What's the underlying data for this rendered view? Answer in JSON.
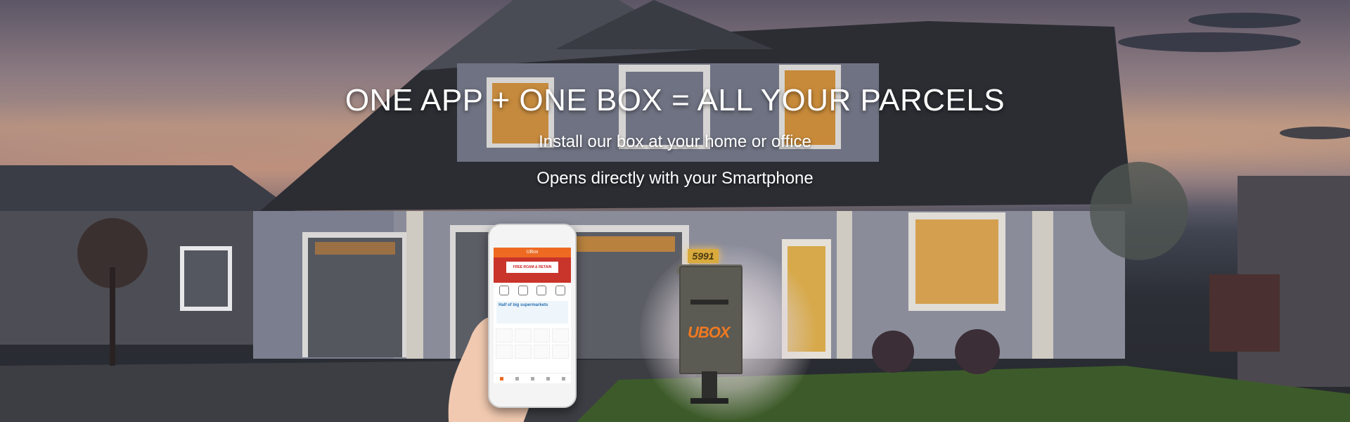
{
  "hero": {
    "headline": "ONE APP + ONE BOX = ALL YOUR PARCELS",
    "line1": "Install our box at your home or office",
    "line2": "Opens directly with your Smartphone"
  },
  "mockup": {
    "app_title": "UBox",
    "banner_text": "FREE ROAM & RETAIN",
    "promo_text": "Half of big supermarkets",
    "box_brand": "UBOX",
    "house_number": "5991"
  },
  "colors": {
    "accent": "#ee6a22",
    "headline": "#ffffff"
  }
}
